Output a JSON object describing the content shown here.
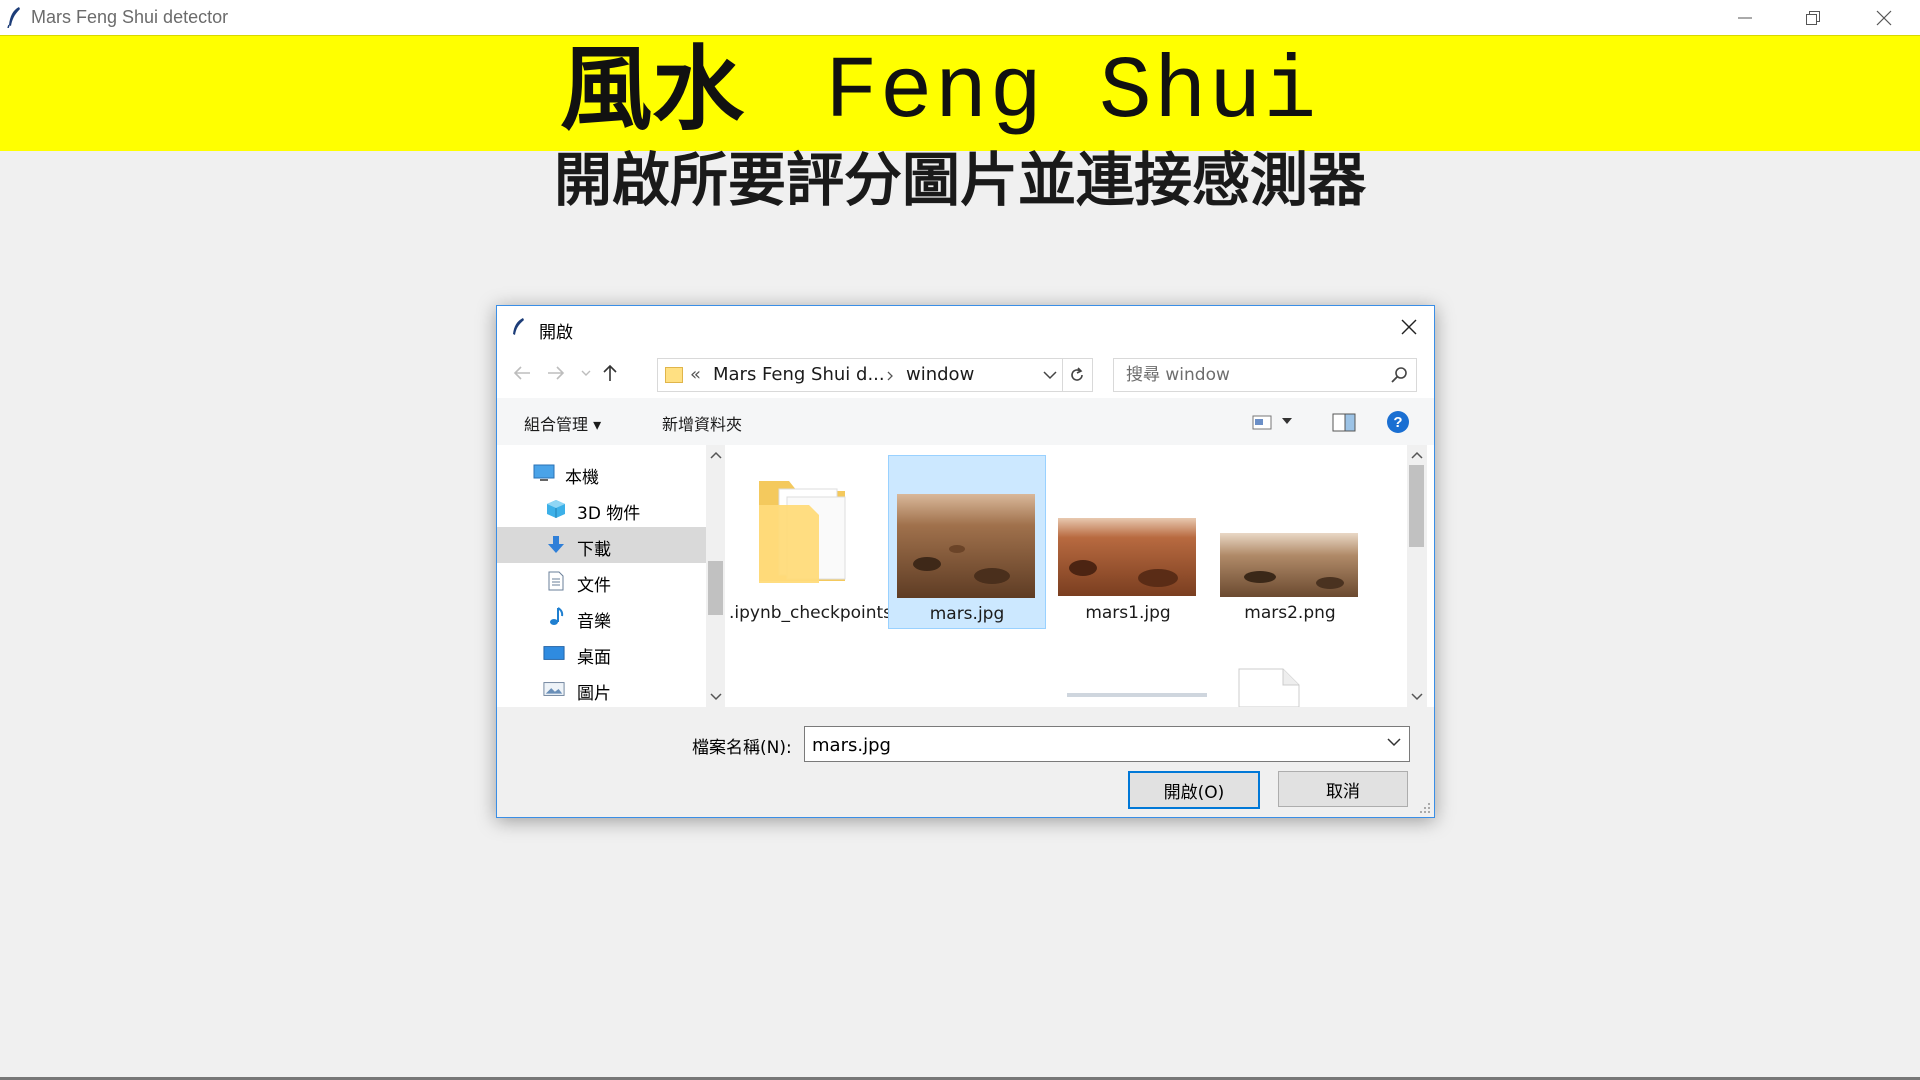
{
  "window": {
    "title": "Mars Feng Shui detector"
  },
  "banner": {
    "title_cn": "風水",
    "title_en": "Feng Shui"
  },
  "subtitle": "開啟所要評分圖片並連接感測器",
  "dialog": {
    "title": "開啟",
    "path": {
      "prefix": "«",
      "segments": [
        "Mars Feng Shui d...",
        "window"
      ]
    },
    "search": {
      "placeholder": "搜尋 window"
    },
    "toolbar": {
      "organize": "組合管理 ▾",
      "new_folder": "新增資料夾"
    },
    "nav_items": [
      {
        "label": "本機",
        "icon": "computer-icon"
      },
      {
        "label": "3D 物件",
        "icon": "cube-icon"
      },
      {
        "label": "下載",
        "icon": "download-arrow-icon"
      },
      {
        "label": "文件",
        "icon": "document-icon"
      },
      {
        "label": "音樂",
        "icon": "music-note-icon"
      },
      {
        "label": "桌面",
        "icon": "desktop-icon"
      },
      {
        "label": "圖片",
        "icon": "pictures-icon"
      }
    ],
    "files": [
      {
        "name": ".ipynb_checkpoints",
        "type": "folder"
      },
      {
        "name": "mars.jpg",
        "type": "image",
        "selected": true
      },
      {
        "name": "mars1.jpg",
        "type": "image"
      },
      {
        "name": "mars2.png",
        "type": "image"
      }
    ],
    "filename": {
      "label": "檔案名稱(N):",
      "value": "mars.jpg"
    },
    "buttons": {
      "open": "開啟(O)",
      "cancel": "取消"
    }
  },
  "colors": {
    "banner": "#ffff00",
    "selection": "#cce8ff",
    "accent": "#0078d7"
  }
}
